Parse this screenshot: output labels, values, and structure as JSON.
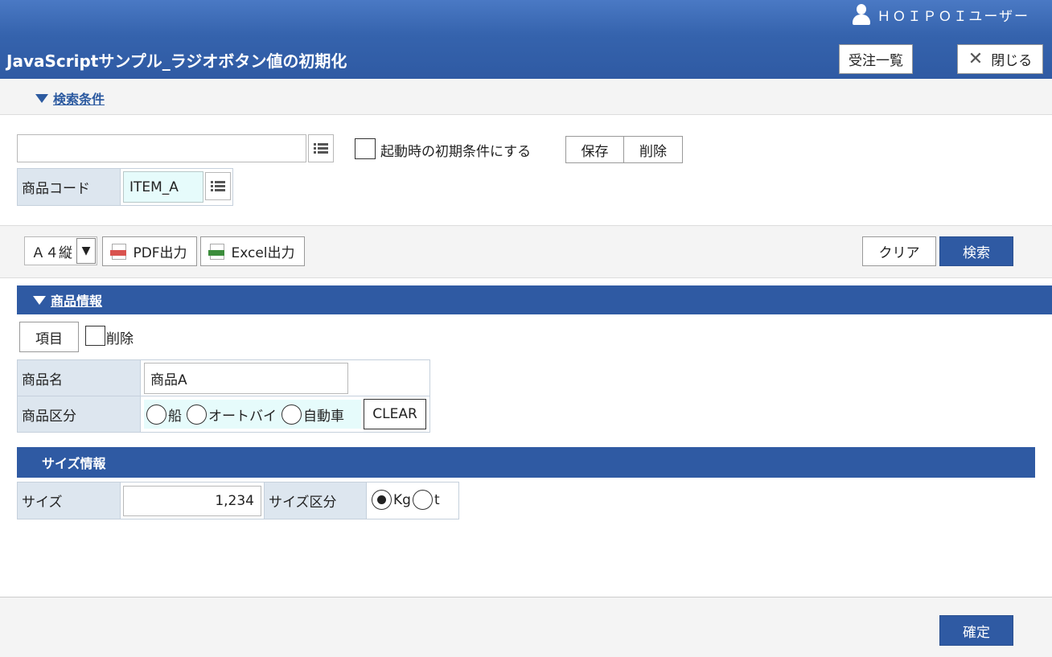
{
  "header": {
    "user_name": "ＨＯＩＰＯＩユーザー",
    "title": "JavaScriptサンプル_ラジオボタン値の初期化",
    "order_list_label": "受注一覧",
    "close_label": "閉じる"
  },
  "search": {
    "toggle_label": "検索条件",
    "condition_value": "",
    "startup_default_label": "起動時の初期条件にする",
    "save_label": "保存",
    "delete_label": "削除",
    "product_code_label": "商品コード",
    "product_code_value": "ITEM_A"
  },
  "toolbar": {
    "paper_size": "Ａ４縦",
    "pdf_label": "PDF出力",
    "excel_label": "Excel出力",
    "clear_label": "クリア",
    "search_label": "検索"
  },
  "product": {
    "section_title": "商品情報",
    "item_button_label": "項目",
    "delete_label": "削除",
    "name_label": "商品名",
    "name_value": "商品A",
    "category_label": "商品区分",
    "category_options": [
      "船",
      "オートバイ",
      "自動車"
    ],
    "clear_label": "CLEAR"
  },
  "size": {
    "section_title": "サイズ情報",
    "size_label": "サイズ",
    "size_value": "1,234",
    "unit_label": "サイズ区分",
    "unit_options": [
      "Kg",
      "t"
    ],
    "unit_selected": "Kg"
  },
  "footer": {
    "confirm_label": "確定"
  },
  "colors": {
    "header_blue": "#2f5aa3",
    "label_bg": "#dde6ef",
    "code_input_bg": "#e6fbfb"
  }
}
